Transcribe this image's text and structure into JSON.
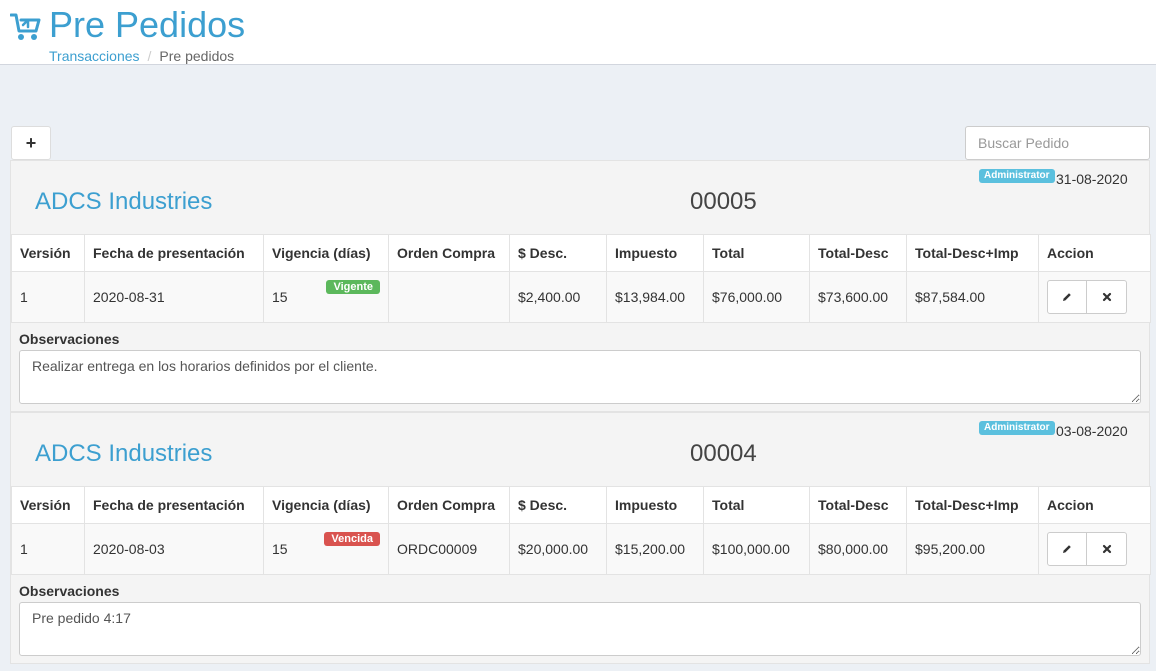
{
  "header": {
    "title": "Pre Pedidos",
    "breadcrumb": {
      "parent": "Transacciones",
      "separator": "/",
      "current": "Pre pedidos"
    }
  },
  "toolbar": {
    "add_label": "+",
    "search_placeholder": "Buscar Pedido",
    "search_value": ""
  },
  "columns": [
    "Versión",
    "Fecha de presentación",
    "Vigencia (días)",
    "Orden Compra",
    "$ Desc.",
    "Impuesto",
    "Total",
    "Total-Desc",
    "Total-Desc+Imp",
    "Accion"
  ],
  "orders": [
    {
      "customer": "ADCS Industries",
      "number": "00005",
      "role_badge": "Administrator",
      "date": "31-08-2020",
      "row": {
        "version": "1",
        "fecha": "2020-08-31",
        "vigencia": "15",
        "status": "Vigente",
        "status_color": "#5cb85c",
        "orden_compra": "",
        "desc": "$2,400.00",
        "impuesto": "$13,984.00",
        "total": "$76,000.00",
        "total_desc": "$73,600.00",
        "total_desc_imp": "$87,584.00"
      },
      "obs_label": "Observaciones",
      "observaciones": "Realizar entrega en los horarios definidos por el cliente."
    },
    {
      "customer": "ADCS Industries",
      "number": "00004",
      "role_badge": "Administrator",
      "date": "03-08-2020",
      "row": {
        "version": "1",
        "fecha": "2020-08-03",
        "vigencia": "15",
        "status": "Vencida",
        "status_color": "#d9534f",
        "orden_compra": "ORDC00009",
        "desc": "$20,000.00",
        "impuesto": "$15,200.00",
        "total": "$100,000.00",
        "total_desc": "$80,000.00",
        "total_desc_imp": "$95,200.00"
      },
      "obs_label": "Observaciones",
      "observaciones": "Pre pedido 4:17"
    }
  ],
  "colors": {
    "accent": "#3c9fd0",
    "info": "#5bc0de",
    "background": "#ecf0f5"
  }
}
